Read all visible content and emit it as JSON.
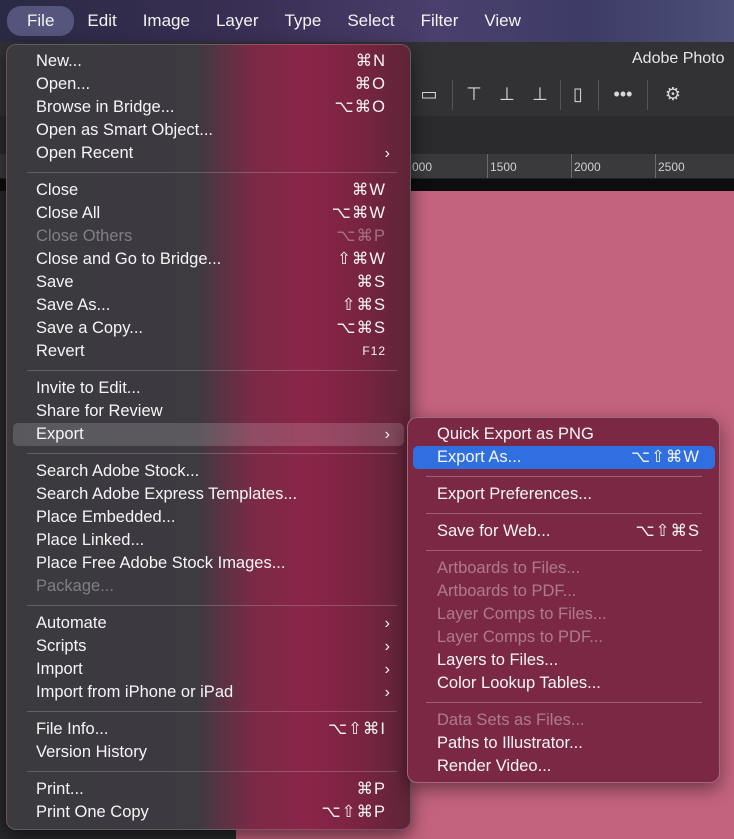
{
  "menubar": {
    "items": [
      "File",
      "Edit",
      "Image",
      "Layer",
      "Type",
      "Select",
      "Filter",
      "View"
    ]
  },
  "app": {
    "title": "Adobe Photo",
    "ruler": [
      "000",
      "1500",
      "2000",
      "2500"
    ]
  },
  "toolbar_icons": [
    "align-top-icon",
    "align-vcenter-icon",
    "align-bottom-icon",
    "distribute-icon",
    "more-icon",
    "gear-icon"
  ],
  "file_menu": {
    "items": [
      {
        "label": "New...",
        "shortcut": "⌘N"
      },
      {
        "label": "Open...",
        "shortcut": "⌘O"
      },
      {
        "label": "Browse in Bridge...",
        "shortcut": "⌥⌘O"
      },
      {
        "label": "Open as Smart Object...",
        "shortcut": ""
      },
      {
        "label": "Open Recent",
        "shortcut": "",
        "submenu": true
      },
      {
        "label": "Close",
        "shortcut": "⌘W"
      },
      {
        "label": "Close All",
        "shortcut": "⌥⌘W"
      },
      {
        "label": "Close Others",
        "shortcut": "⌥⌘P",
        "disabled": true
      },
      {
        "label": "Close and Go to Bridge...",
        "shortcut": "⇧⌘W"
      },
      {
        "label": "Save",
        "shortcut": "⌘S"
      },
      {
        "label": "Save As...",
        "shortcut": "⇧⌘S"
      },
      {
        "label": "Save a Copy...",
        "shortcut": "⌥⌘S"
      },
      {
        "label": "Revert",
        "shortcut": "F12"
      },
      {
        "label": "Invite to Edit...",
        "shortcut": ""
      },
      {
        "label": "Share for Review",
        "shortcut": ""
      },
      {
        "label": "Export",
        "shortcut": "",
        "submenu": true,
        "highlighted": true
      },
      {
        "label": "Search Adobe Stock...",
        "shortcut": ""
      },
      {
        "label": "Search Adobe Express Templates...",
        "shortcut": ""
      },
      {
        "label": "Place Embedded...",
        "shortcut": ""
      },
      {
        "label": "Place Linked...",
        "shortcut": ""
      },
      {
        "label": "Place Free Adobe Stock Images...",
        "shortcut": ""
      },
      {
        "label": "Package...",
        "shortcut": "",
        "disabled": true
      },
      {
        "label": "Automate",
        "shortcut": "",
        "submenu": true
      },
      {
        "label": "Scripts",
        "shortcut": "",
        "submenu": true
      },
      {
        "label": "Import",
        "shortcut": "",
        "submenu": true
      },
      {
        "label": "Import from iPhone or iPad",
        "shortcut": "",
        "submenu": true
      },
      {
        "label": "File Info...",
        "shortcut": "⌥⇧⌘I"
      },
      {
        "label": "Version History",
        "shortcut": ""
      },
      {
        "label": "Print...",
        "shortcut": "⌘P"
      },
      {
        "label": "Print One Copy",
        "shortcut": "⌥⇧⌘P"
      }
    ]
  },
  "export_menu": {
    "items": [
      {
        "label": "Quick Export as PNG",
        "shortcut": ""
      },
      {
        "label": "Export As...",
        "shortcut": "⌥⇧⌘W",
        "selected": true
      },
      {
        "label": "Export Preferences...",
        "shortcut": ""
      },
      {
        "label": "Save for Web...",
        "shortcut": "⌥⇧⌘S"
      },
      {
        "label": "Artboards to Files...",
        "shortcut": "",
        "disabled": true
      },
      {
        "label": "Artboards to PDF...",
        "shortcut": "",
        "disabled": true
      },
      {
        "label": "Layer Comps to Files...",
        "shortcut": "",
        "disabled": true
      },
      {
        "label": "Layer Comps to PDF...",
        "shortcut": "",
        "disabled": true
      },
      {
        "label": "Layers to Files...",
        "shortcut": ""
      },
      {
        "label": "Color Lookup Tables...",
        "shortcut": ""
      },
      {
        "label": "Data Sets as Files...",
        "shortcut": "",
        "disabled": true
      },
      {
        "label": "Paths to Illustrator...",
        "shortcut": ""
      },
      {
        "label": "Render Video...",
        "shortcut": ""
      }
    ]
  },
  "colors": {
    "selection": "#2f6fe0",
    "canvas": "#c4637e",
    "submenu_bg": "#7b2845"
  }
}
